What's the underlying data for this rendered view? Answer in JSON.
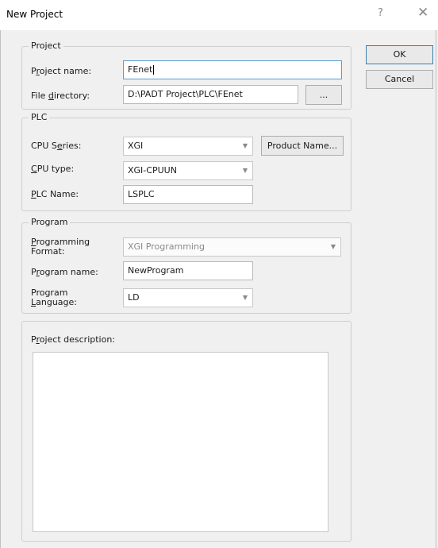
{
  "window": {
    "title": "New Project",
    "help_glyph": "?",
    "close_glyph": "✕"
  },
  "project_group": {
    "legend": "Project",
    "project_name_label": "Project name:",
    "project_name_value": "FEnet",
    "file_directory_label": "File directory:",
    "file_directory_value": "D:\\PADT Project\\PLC\\FEnet",
    "browse_label": "..."
  },
  "plc_group": {
    "legend": "PLC",
    "cpu_series_label": "CPU Series:",
    "cpu_series_value": "XGI",
    "product_name_button": "Product Name...",
    "cpu_type_label": "CPU type:",
    "cpu_type_value": "XGI-CPUUN",
    "plc_name_label": "PLC Name:",
    "plc_name_value": "LSPLC"
  },
  "program_group": {
    "legend": "Program",
    "programming_format_label_line1": "Programming",
    "programming_format_label_line2": "Format:",
    "programming_format_value": "XGI Programming",
    "program_name_label": "Program name:",
    "program_name_value": "NewProgram",
    "program_language_label_line1": "Program",
    "program_language_label_line2": "Language:",
    "program_language_value": "LD"
  },
  "description_group": {
    "label": "Project description:",
    "value": ""
  },
  "buttons": {
    "ok": "OK",
    "cancel": "Cancel"
  }
}
